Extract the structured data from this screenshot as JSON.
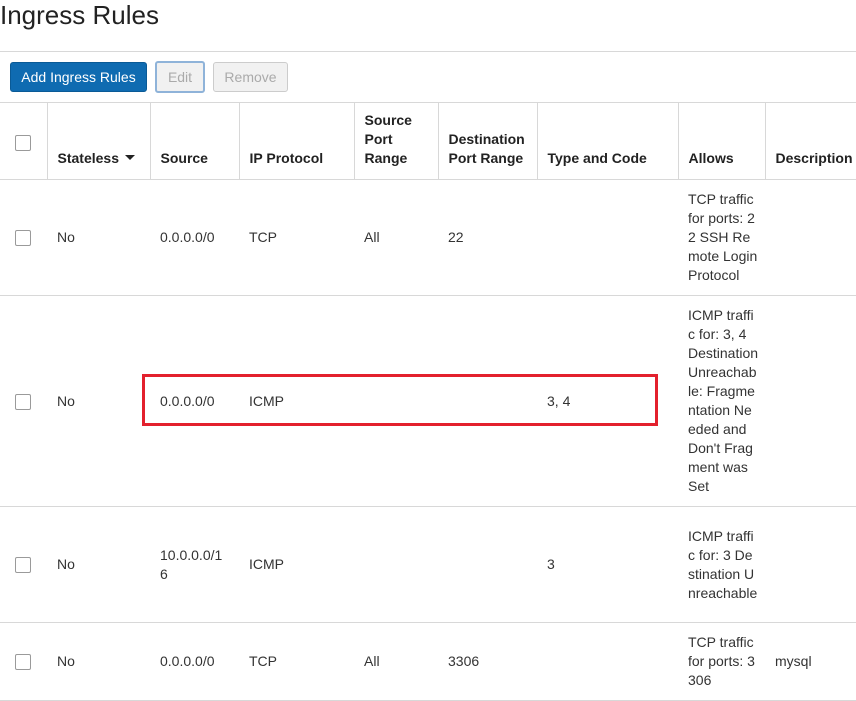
{
  "page": {
    "title": "Ingress Rules"
  },
  "toolbar": {
    "add_label": "Add Ingress Rules",
    "edit_label": "Edit",
    "remove_label": "Remove"
  },
  "table": {
    "columns": {
      "stateless": "Stateless",
      "source": "Source",
      "ip_protocol": "IP Protocol",
      "source_port_range": "Source Port Range",
      "destination_port_range": "Destination Port Range",
      "type_and_code": "Type and Code",
      "allows": "Allows",
      "description": "Description"
    },
    "rows": [
      {
        "stateless": "No",
        "source": "0.0.0.0/0",
        "ip_protocol": "TCP",
        "source_port_range": "All",
        "destination_port_range": "22",
        "type_and_code": "",
        "allows": "TCP traffic for ports: 22 SSH Remote Login Protocol",
        "description": ""
      },
      {
        "stateless": "No",
        "source": "0.0.0.0/0",
        "ip_protocol": "ICMP",
        "source_port_range": "",
        "destination_port_range": "",
        "type_and_code": "3, 4",
        "allows": "ICMP traffic for: 3, 4 Destination Unreachable: Fragmentation Needed and Don't Fragment was Set",
        "description": ""
      },
      {
        "stateless": "No",
        "source": "10.0.0.0/16",
        "ip_protocol": "ICMP",
        "source_port_range": "",
        "destination_port_range": "",
        "type_and_code": "3",
        "allows": "ICMP traffic for: 3 Destination Unreachable",
        "description": ""
      },
      {
        "stateless": "No",
        "source": "0.0.0.0/0",
        "ip_protocol": "TCP",
        "source_port_range": "All",
        "destination_port_range": "3306",
        "type_and_code": "",
        "allows": "TCP traffic for ports: 3306",
        "description": "mysql"
      }
    ]
  },
  "colors": {
    "primary_button": "#0f6bb1",
    "highlight_border": "#e3202d"
  }
}
